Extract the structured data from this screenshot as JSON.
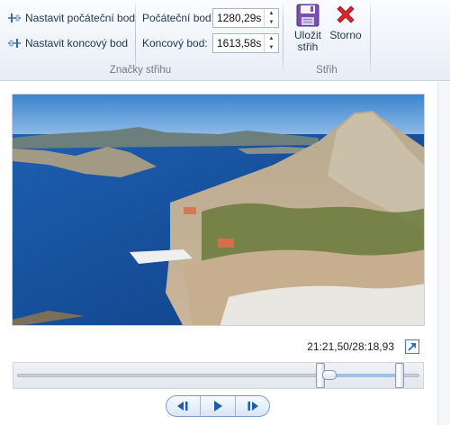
{
  "ribbon": {
    "markers_group": {
      "set_start_label": "Nastavit počáteční bod",
      "set_end_label": "Nastavit koncový bod",
      "start_point_label": "Počáteční bod:",
      "start_point_value": "1280,29s",
      "end_point_label": "Koncový bod:",
      "end_point_value": "1613,58s",
      "group_label": "Značky střihu"
    },
    "trim_group": {
      "save_line1": "Uložit",
      "save_line2": "střih",
      "cancel_label": "Storno",
      "group_label": "Střih"
    }
  },
  "preview": {
    "time_readout": "21:21,50/28:18,93",
    "progress": {
      "current_seconds": 1281.5,
      "duration_seconds": 1698.93,
      "trim_start_seconds": 1280.29,
      "trim_end_seconds": 1613.58
    }
  },
  "icons": {
    "set_start": "marker-start-icon",
    "set_end": "marker-end-icon",
    "save": "floppy-disk-icon",
    "cancel": "red-x-icon",
    "expand": "expand-arrow-icon",
    "prev_frame": "previous-frame-icon",
    "play": "play-icon",
    "next_frame": "next-frame-icon"
  },
  "colors": {
    "ribbon_bg": "#edf2f9",
    "accent_blue": "#2f6db5",
    "cancel_red": "#d8262c",
    "save_purple": "#7a4fb0"
  }
}
